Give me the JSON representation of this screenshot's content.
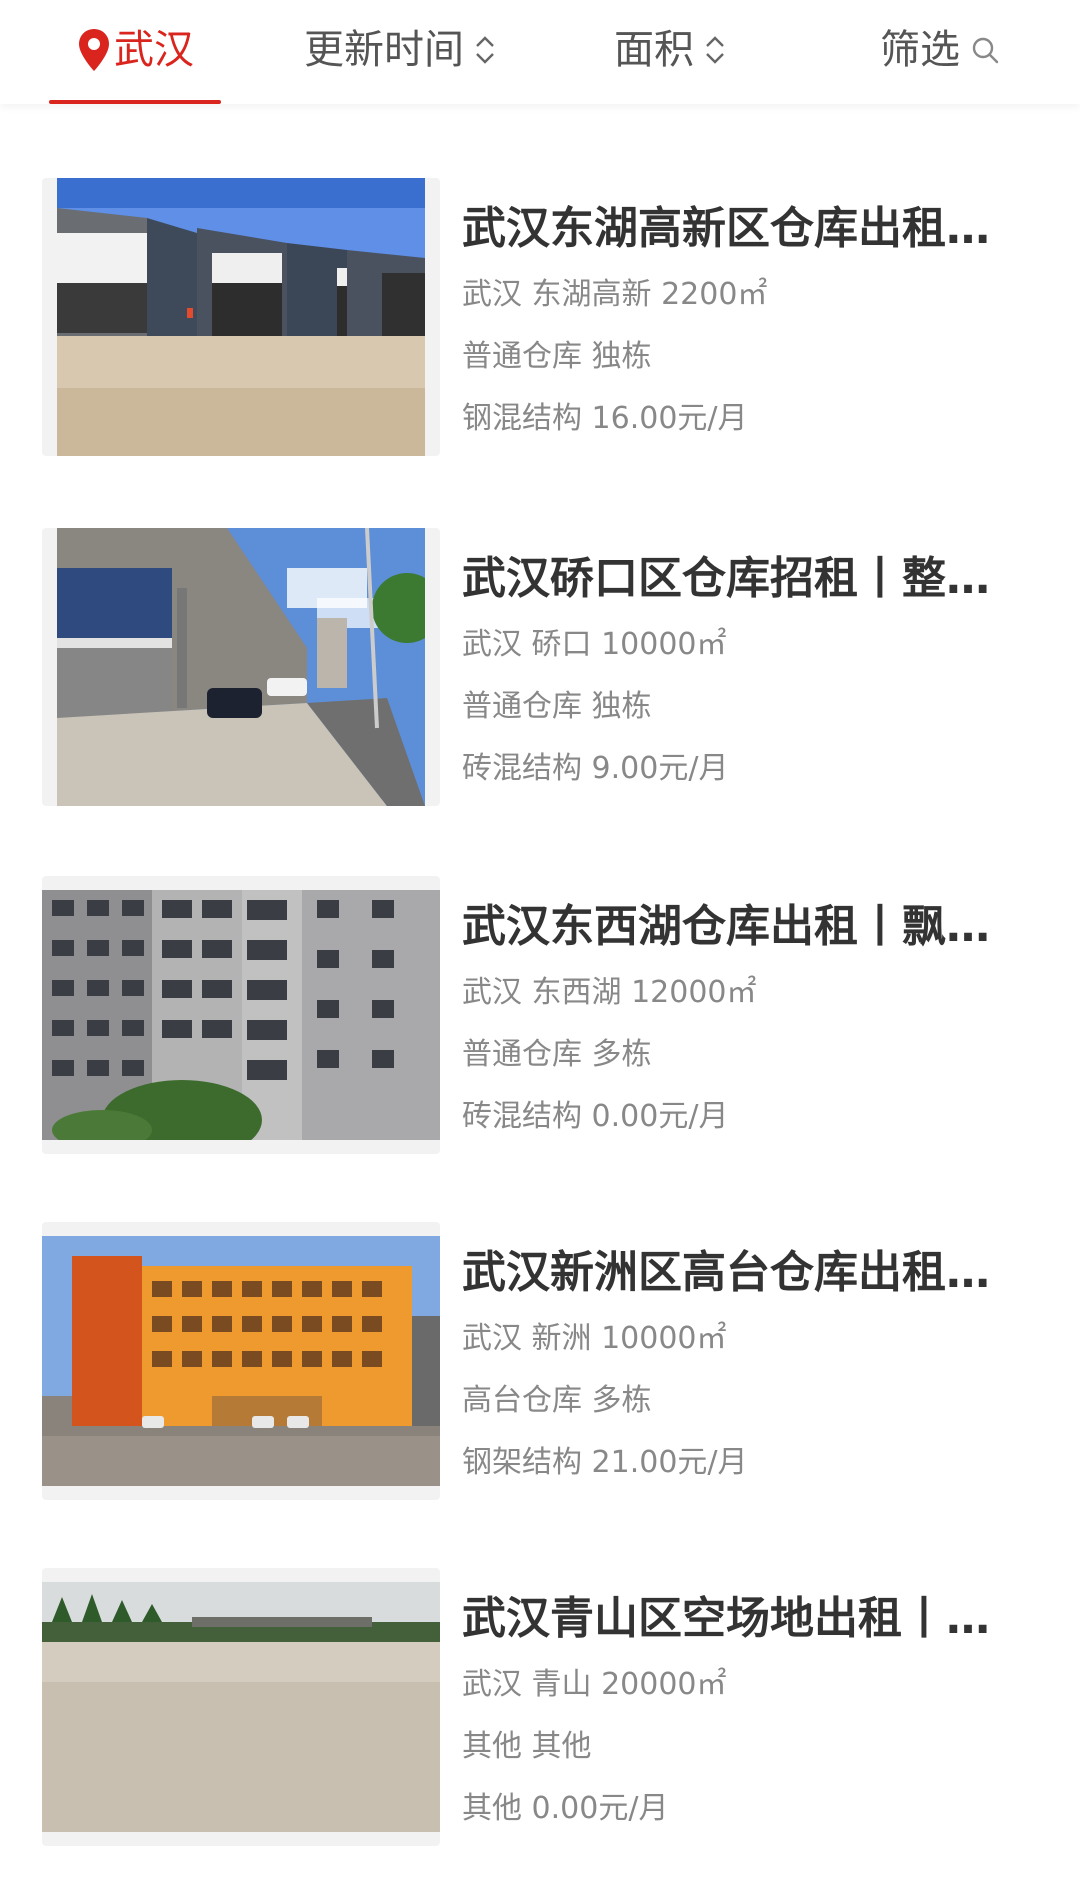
{
  "filter_bar": {
    "location_label": "武汉",
    "update_time_label": "更新时间",
    "area_label": "面积",
    "screen_label": "筛选",
    "accent_color": "#d9251d"
  },
  "listings": [
    {
      "title": "武汉东湖高新区仓库出租…",
      "location_area": "武汉 东湖高新 2200㎡",
      "type": "普通仓库 独栋",
      "structure_price": "钢混结构 16.00元/月",
      "image": "warehouse-steel-sheds"
    },
    {
      "title": "武汉硚口区仓库招租丨整…",
      "location_area": "武汉 硚口 10000㎡",
      "type": "普通仓库 独栋",
      "structure_price": "砖混结构 9.00元/月",
      "image": "livestream-warehouse-building"
    },
    {
      "title": "武汉东西湖仓库出租丨飘…",
      "location_area": "武汉 东西湖 12000㎡",
      "type": "普通仓库 多栋",
      "structure_price": "砖混结构 0.00元/月",
      "image": "multi-storey-building"
    },
    {
      "title": "武汉新洲区高台仓库出租…",
      "location_area": "武汉 新洲 10000㎡",
      "type": "高台仓库 多栋",
      "structure_price": "钢架结构 21.00元/月",
      "image": "orange-office-building"
    },
    {
      "title": "武汉青山区空场地出租丨…",
      "location_area": "武汉 青山 20000㎡",
      "type": "其他 其他",
      "structure_price": "其他 0.00元/月",
      "image": "empty-lot"
    }
  ]
}
